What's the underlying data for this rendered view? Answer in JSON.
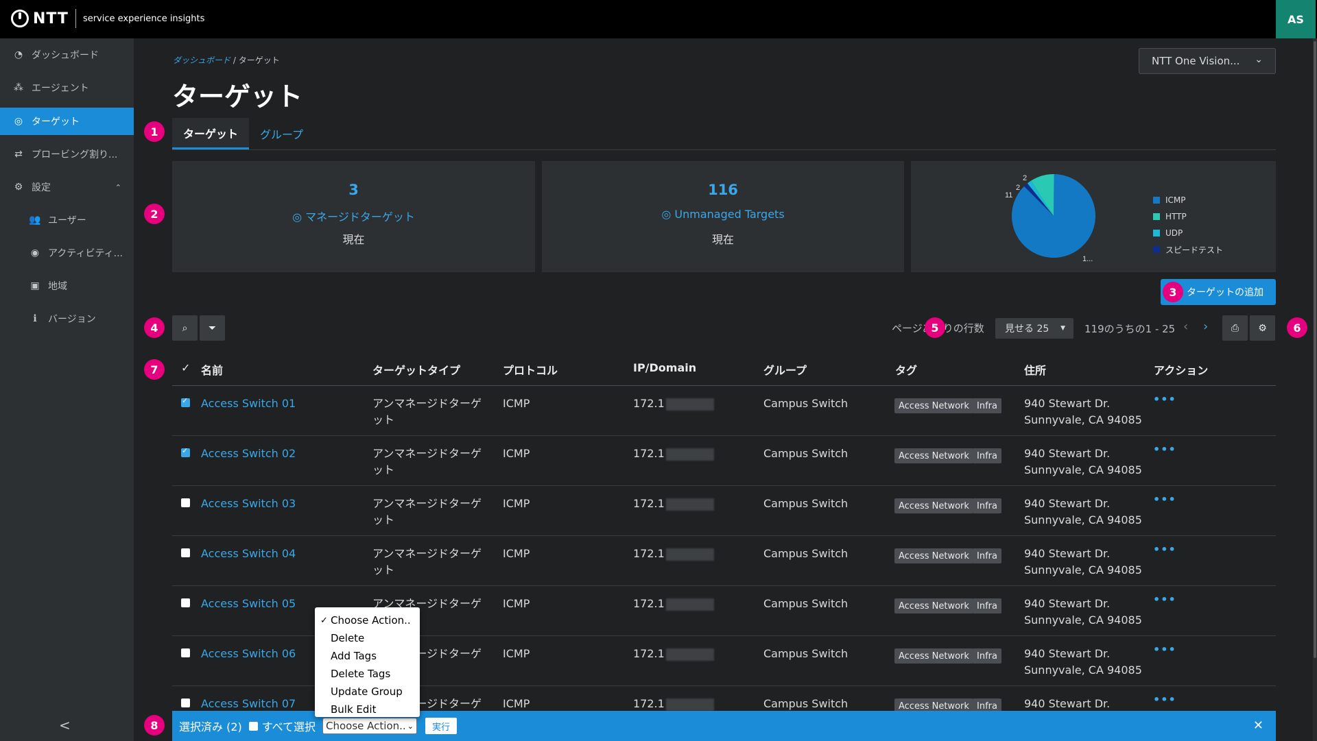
{
  "header": {
    "logo_text": "NTT",
    "logo_sub": "service experience insights",
    "avatar_initials": "AS"
  },
  "sidebar": {
    "items": [
      {
        "label": "ダッシュボード",
        "icon": "dashboard-icon"
      },
      {
        "label": "エージェント",
        "icon": "agent-icon"
      },
      {
        "label": "ターゲット",
        "icon": "target-icon",
        "active": true
      },
      {
        "label": "プロービング割り...",
        "icon": "exchange-icon"
      },
      {
        "label": "設定",
        "icon": "gear-icon"
      },
      {
        "label": "ユーザー",
        "icon": "users-icon"
      },
      {
        "label": "アクティビティ...",
        "icon": "eye-icon"
      },
      {
        "label": "地域",
        "icon": "region-icon"
      },
      {
        "label": "バージョン",
        "icon": "info-icon"
      }
    ],
    "collapse_glyph": "<"
  },
  "breadcrumb": {
    "parent": "ダッシュボード",
    "separator": "/",
    "current": "ターゲット"
  },
  "page": {
    "title": "ターゲット"
  },
  "org_select": {
    "value": "NTT One Vision..."
  },
  "tabs": [
    {
      "label": "ターゲット",
      "active": true
    },
    {
      "label": "グループ",
      "active": false
    }
  ],
  "badges": [
    "1",
    "2",
    "3",
    "4",
    "5",
    "6",
    "7",
    "8"
  ],
  "cards": {
    "managed": {
      "count": "3",
      "label": "マネージドターゲット",
      "sub": "現在"
    },
    "unmanaged": {
      "count": "116",
      "label": "Unmanaged Targets",
      "sub": "現在"
    }
  },
  "chart_data": {
    "type": "pie",
    "slice_labels": [
      "11",
      "2",
      "2",
      "1..."
    ],
    "series": [
      {
        "name": "ICMP",
        "value": 104,
        "color": "#1479c4"
      },
      {
        "name": "HTTP",
        "value": 11,
        "color": "#2ac9b4"
      },
      {
        "name": "UDP",
        "value": 2,
        "color": "#1cb8d8"
      },
      {
        "name": "スピードテスト",
        "value": 2,
        "color": "#0b2f8c"
      }
    ]
  },
  "add_button": {
    "label": "ターゲットの追加"
  },
  "pagination": {
    "rows_label": "ページあたりの行数",
    "rows_select": "見せる 25",
    "info": "119のうちの1 - 25"
  },
  "table": {
    "columns": [
      "名前",
      "ターゲットタイプ",
      "プロトコル",
      "IP/Domain",
      "グループ",
      "タグ",
      "住所",
      "アクション"
    ],
    "rows": [
      {
        "checked": true,
        "name": "Access Switch 01",
        "type_l1": "アンマネージドターゲ",
        "type_l2": "ット",
        "protocol": "ICMP",
        "ip": "172.1",
        "group": "Campus Switch",
        "tag1": "Access Network",
        "tag2": "Infra",
        "addr_l1": "940 Stewart Dr.",
        "addr_l2": "Sunnyvale, CA 94085"
      },
      {
        "checked": true,
        "name": "Access Switch 02",
        "type_l1": "アンマネージドターゲ",
        "type_l2": "ット",
        "protocol": "ICMP",
        "ip": "172.1",
        "group": "Campus Switch",
        "tag1": "Access Network",
        "tag2": "Infra",
        "addr_l1": "940 Stewart Dr.",
        "addr_l2": "Sunnyvale, CA 94085"
      },
      {
        "checked": false,
        "name": "Access Switch 03",
        "type_l1": "アンマネージドターゲ",
        "type_l2": "ット",
        "protocol": "ICMP",
        "ip": "172.1",
        "group": "Campus Switch",
        "tag1": "Access Network",
        "tag2": "Infra",
        "addr_l1": "940 Stewart Dr.",
        "addr_l2": "Sunnyvale, CA 94085"
      },
      {
        "checked": false,
        "name": "Access Switch 04",
        "type_l1": "アンマネージドターゲ",
        "type_l2": "ット",
        "protocol": "ICMP",
        "ip": "172.1",
        "group": "Campus Switch",
        "tag1": "Access Network",
        "tag2": "Infra",
        "addr_l1": "940 Stewart Dr.",
        "addr_l2": "Sunnyvale, CA 94085"
      },
      {
        "checked": false,
        "name": "Access Switch 05",
        "type_l1": "アンマネージドターゲ",
        "type_l2": "ット",
        "protocol": "ICMP",
        "ip": "172.1",
        "group": "Campus Switch",
        "tag1": "Access Network",
        "tag2": "Infra",
        "addr_l1": "940 Stewart Dr.",
        "addr_l2": "Sunnyvale, CA 94085"
      },
      {
        "checked": false,
        "name": "Access Switch 06",
        "type_l1": "アンマネージドターゲ",
        "type_l2": "ット",
        "protocol": "ICMP",
        "ip": "172.1",
        "group": "Campus Switch",
        "tag1": "Access Network",
        "tag2": "Infra",
        "addr_l1": "940 Stewart Dr.",
        "addr_l2": "Sunnyvale, CA 94085"
      },
      {
        "checked": false,
        "name": "Access Switch 07",
        "type_l1": "アンマネージドターゲ",
        "type_l2": "ット",
        "protocol": "ICMP",
        "ip": "172.1",
        "group": "Campus Switch",
        "tag1": "Access Network",
        "tag2": "Infra",
        "addr_l1": "940 Stewart Dr.",
        "addr_l2": ""
      }
    ],
    "action_glyph": "•••"
  },
  "dropdown": {
    "items": [
      "Choose Action..",
      "Delete",
      "Add Tags",
      "Delete Tags",
      "Update Group",
      "Bulk Edit"
    ],
    "check_glyph": "✓"
  },
  "bulkbar": {
    "selected_text": "選択済み (2)",
    "select_all": "すべて選択",
    "action_value": "Choose Action..",
    "run_label": "実行",
    "close_glyph": "✕"
  }
}
